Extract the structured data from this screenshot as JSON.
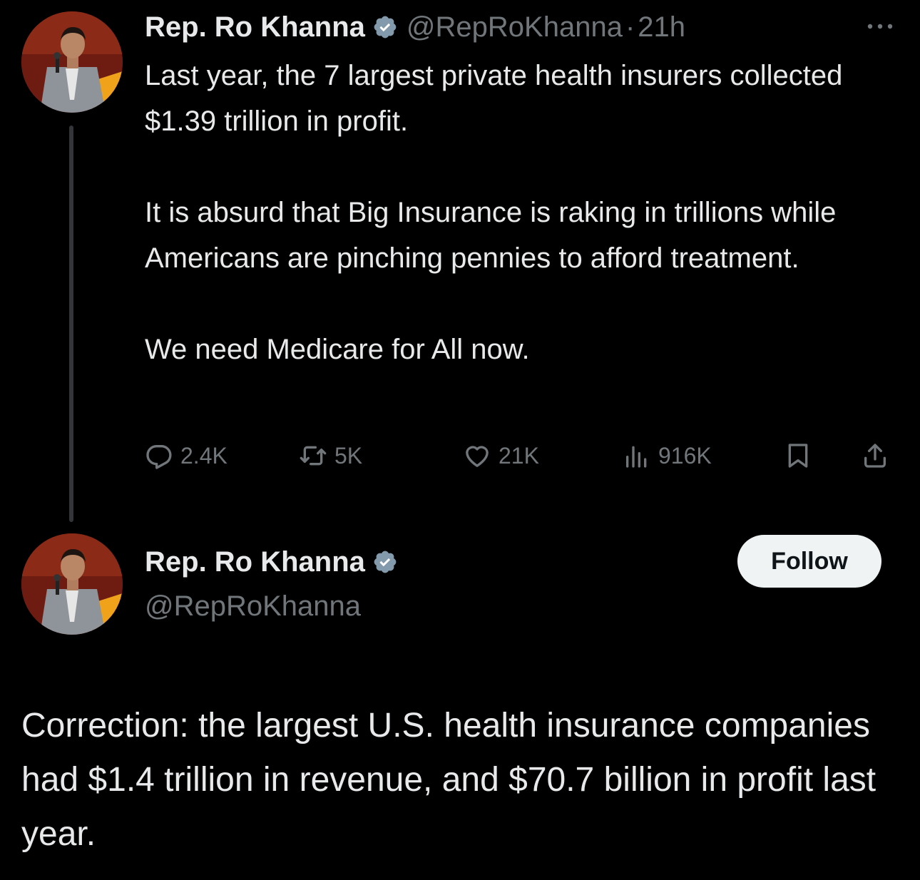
{
  "colors": {
    "background": "#000000",
    "primary_text": "#e7e9ea",
    "secondary_text": "#71767b",
    "verified_badge": "#829aab",
    "follow_button_bg": "#eff3f4",
    "follow_button_text": "#0f1419"
  },
  "tweet": {
    "author": {
      "display_name": "Rep. Ro Khanna",
      "handle": "@RepRoKhanna",
      "verified": true,
      "avatar_icon": "avatar-photo"
    },
    "separator": "·",
    "time": "21h",
    "more_icon": "more-options-icon",
    "paragraphs": [
      "Last year, the 7 largest private health insurers collected $1.39 trillion in profit.",
      "It is absurd that Big Insurance is raking in trillions while Americans are pinching pennies to afford treatment.",
      "We need Medicare for All now."
    ],
    "actions": {
      "reply": {
        "icon": "reply-icon",
        "count": "2.4K"
      },
      "retweet": {
        "icon": "retweet-icon",
        "count": "5K"
      },
      "like": {
        "icon": "like-icon",
        "count": "21K"
      },
      "views": {
        "icon": "views-icon",
        "count": "916K"
      },
      "bookmark": {
        "icon": "bookmark-icon"
      },
      "share": {
        "icon": "share-icon"
      }
    }
  },
  "reply": {
    "author": {
      "display_name": "Rep. Ro Khanna",
      "handle": "@RepRoKhanna",
      "verified": true,
      "avatar_icon": "avatar-photo"
    },
    "follow_label": "Follow",
    "text": "Correction: the largest U.S. health insurance companies had $1.4 trillion in revenue, and $70.7 billion in profit last year."
  }
}
